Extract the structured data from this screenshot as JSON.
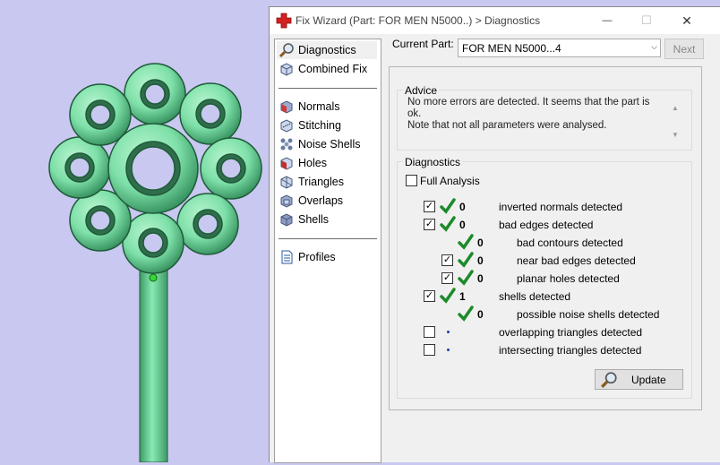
{
  "window": {
    "title": "Fix Wizard (Part: FOR MEN N5000..) > Diagnostics",
    "minimize_symbol": "—",
    "maximize_symbol": "☐",
    "close_symbol": "✕"
  },
  "nav": {
    "top_items": [
      {
        "label": "Diagnostics",
        "icon": "magnifier-icon",
        "active": true
      },
      {
        "label": "Combined Fix",
        "icon": "cube-icon"
      }
    ],
    "fix_items": [
      {
        "label": "Normals",
        "icon": "normals-cube-icon"
      },
      {
        "label": "Stitching",
        "icon": "stitching-cube-icon"
      },
      {
        "label": "Noise Shells",
        "icon": "noise-shells-icon"
      },
      {
        "label": "Holes",
        "icon": "holes-cube-icon"
      },
      {
        "label": "Triangles",
        "icon": "triangles-cube-icon"
      },
      {
        "label": "Overlaps",
        "icon": "overlaps-cube-icon"
      },
      {
        "label": "Shells",
        "icon": "shells-cube-icon"
      }
    ],
    "bottom_items": [
      {
        "label": "Profiles",
        "icon": "document-icon"
      }
    ]
  },
  "current_part": {
    "label": "Current Part:",
    "value": "FOR MEN N5000...4",
    "next_label": "Next"
  },
  "advice": {
    "title": "Advice",
    "line1": "No more errors are detected. It seems that the part is ok.",
    "line2": "Note that not all parameters were analysed."
  },
  "diagnostics": {
    "title": "Diagnostics",
    "full_analysis_label": "Full Analysis",
    "full_analysis_checked": false,
    "rows": [
      {
        "checked": true,
        "status": "ok",
        "count": "0",
        "label": "inverted normals detected",
        "indent": 0
      },
      {
        "checked": true,
        "status": "ok",
        "count": "0",
        "label": "bad edges detected",
        "indent": 0
      },
      {
        "checked": null,
        "status": "ok",
        "count": "0",
        "label": "bad contours detected",
        "indent": 1
      },
      {
        "checked": true,
        "status": "ok",
        "count": "0",
        "label": "near bad edges detected",
        "indent": 1
      },
      {
        "checked": true,
        "status": "ok",
        "count": "0",
        "label": "planar holes detected",
        "indent": 1
      },
      {
        "checked": true,
        "status": "ok",
        "count": "1",
        "label": "shells detected",
        "indent": 0
      },
      {
        "checked": null,
        "status": "ok",
        "count": "0",
        "label": "possible noise shells detected",
        "indent": 1
      },
      {
        "checked": false,
        "status": "none",
        "count": "",
        "label": "overlapping triangles detected",
        "indent": 0
      },
      {
        "checked": false,
        "status": "none",
        "count": "",
        "label": "intersecting triangles detected",
        "indent": 0
      }
    ],
    "update_label": "Update"
  },
  "colors": {
    "viewport_bg": "#c8c8f0",
    "model_green": "#7ee0a8",
    "check_green": "#1d8a2a",
    "title_icon_red": "#d42020"
  }
}
